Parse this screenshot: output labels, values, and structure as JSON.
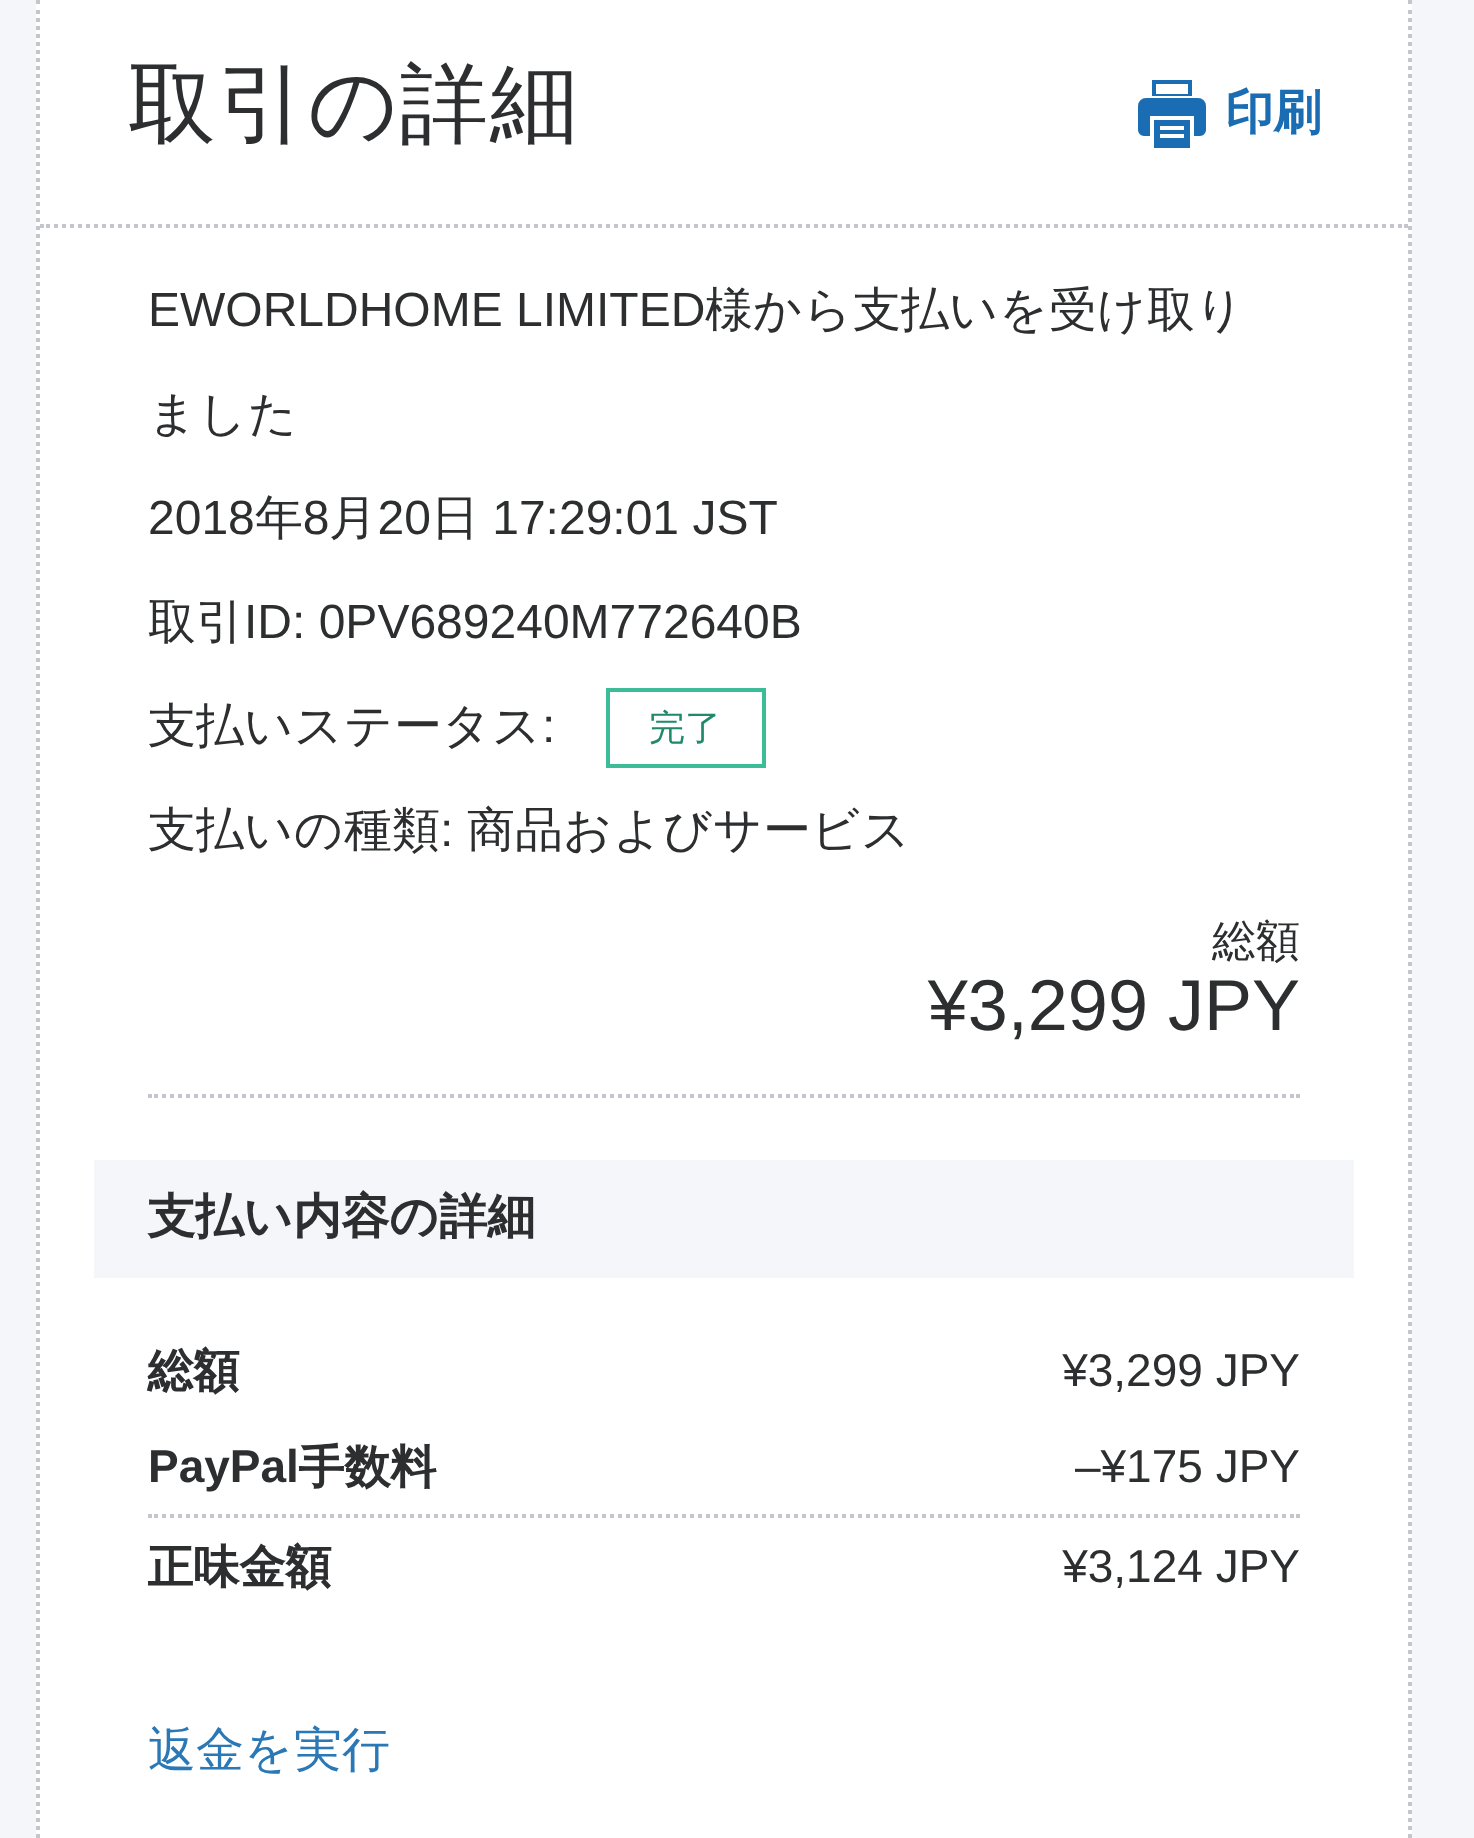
{
  "header": {
    "title": "取引の詳細",
    "print_link": "印刷"
  },
  "transaction": {
    "message": "EWORLDHOME LIMITED様から支払いを受け取りました",
    "date": "2018年8月20日 17:29:01 JST",
    "transaction_id": "取引ID: 0PV689240M772640B",
    "status": {
      "label": "支払いステータス:",
      "value": "完了"
    },
    "payment_type": "支払いの種類: 商品およびサービス",
    "total_label": "総額",
    "total_amount": "¥3,299 JPY"
  },
  "payment_details": {
    "title": "支払い内容の詳細",
    "rows": [
      {
        "kind": "item",
        "label": "総額",
        "amount": "¥3,299 JPY"
      },
      {
        "kind": "item",
        "label": "PayPal手数料",
        "amount": "–¥175 JPY"
      },
      {
        "kind": "net",
        "label": "正味金額",
        "amount": "¥3,124 JPY"
      }
    ]
  },
  "refund_link": "返金を実行"
}
